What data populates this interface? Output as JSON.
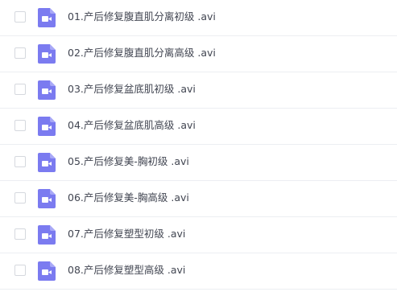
{
  "files": [
    {
      "name": "01.产后修复腹直肌分离初级 .avi",
      "icon": "video-file-icon"
    },
    {
      "name": "02.产后修复腹直肌分离高级 .avi",
      "icon": "video-file-icon"
    },
    {
      "name": "03.产后修复盆底肌初级 .avi",
      "icon": "video-file-icon"
    },
    {
      "name": "04.产后修复盆底肌高级 .avi",
      "icon": "video-file-icon"
    },
    {
      "name": "05.产后修复美-胸初级 .avi",
      "icon": "video-file-icon"
    },
    {
      "name": "06.产后修复美-胸高级 .avi",
      "icon": "video-file-icon"
    },
    {
      "name": "07.产后修复塑型初级 .avi",
      "icon": "video-file-icon"
    },
    {
      "name": "08.产后修复塑型高级 .avi",
      "icon": "video-file-icon"
    }
  ],
  "colors": {
    "icon": "#7b7bf0",
    "text": "#414551",
    "divider": "#eceef2",
    "checkbox_border": "#d5d8de"
  }
}
